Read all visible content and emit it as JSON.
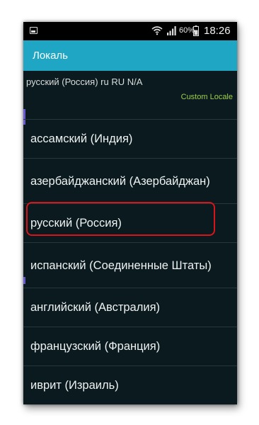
{
  "status_bar": {
    "battery_pct": "60%",
    "time": "18:26"
  },
  "app_bar": {
    "title": "Локаль"
  },
  "current_locale": {
    "info": "русский (Россия)  ru RU N/A",
    "custom_locale_label": "Custom Locale"
  },
  "locales": [
    {
      "label": "ассамский (Индия)"
    },
    {
      "label": "азербайджанский (Азербайджан)"
    },
    {
      "label": "русский (Россия)",
      "highlighted": true
    },
    {
      "label": "испанский (Соединенные Штаты)"
    },
    {
      "label": "английский (Австралия)"
    },
    {
      "label": "французский (Франция)"
    },
    {
      "label": "иврит (Израиль)"
    }
  ],
  "colors": {
    "app_bar": "#1fa6c4",
    "background": "#0b1a1e",
    "highlight_border": "#d8151b",
    "custom_locale_text": "#9ecf4a"
  }
}
